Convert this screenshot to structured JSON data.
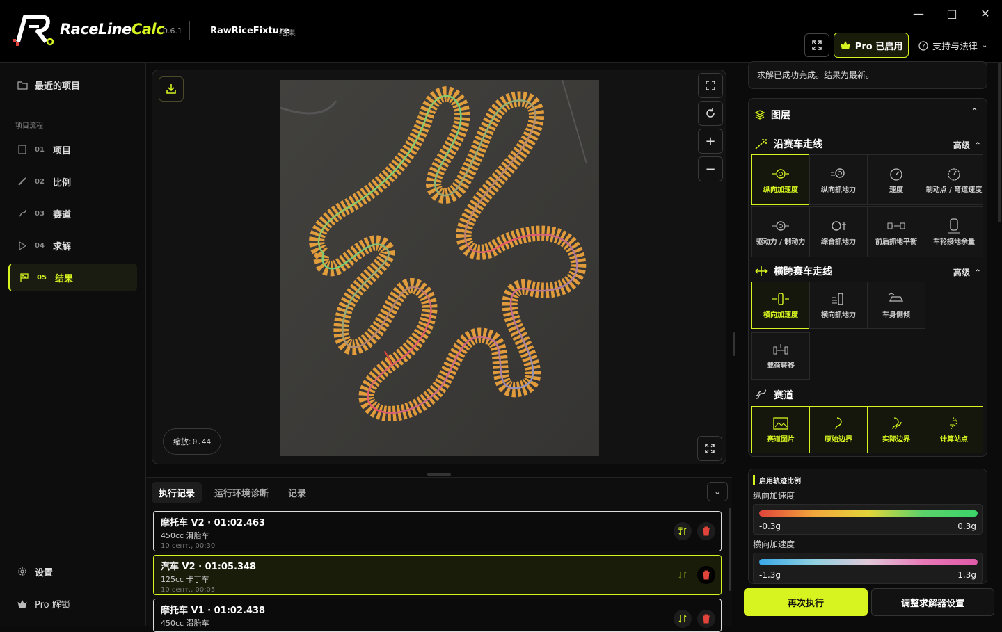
{
  "app": {
    "name_a": "RaceLine",
    "name_b": "Calc",
    "version": "0.6.1",
    "project_name": "RawRiceFixture",
    "project_sub": "结果"
  },
  "titlebar": {
    "pro_label": "Pro 已启用",
    "support_label": "支持与法律"
  },
  "sidebar": {
    "recent": "最近的项目",
    "section": "项目流程",
    "steps": [
      {
        "num": "01",
        "label": "项目"
      },
      {
        "num": "02",
        "label": "比例"
      },
      {
        "num": "03",
        "label": "赛道"
      },
      {
        "num": "04",
        "label": "求解"
      },
      {
        "num": "05",
        "label": "结果"
      }
    ],
    "settings": "设置",
    "pro_unlock": "Pro 解锁"
  },
  "viewer": {
    "zoom_label": "缩放:",
    "zoom_value": "0.44"
  },
  "bottom": {
    "tabs": [
      "执行记录",
      "运行环境诊断",
      "记录"
    ],
    "runs": [
      {
        "title": "摩托车 V2 · 01:02.463",
        "sub": "450cc 滑胎车",
        "date": "10 сент., 00:30"
      },
      {
        "title": "汽车 V2 · 01:05.348",
        "sub": "125cc 卡丁车",
        "date": "10 сент., 00:05"
      },
      {
        "title": "摩托车 V1 · 01:02.438",
        "sub": "450cc 滑胎车",
        "date": ""
      }
    ]
  },
  "right": {
    "status": "求解已成功完成。结果为最新。",
    "layers_title": "图层",
    "along_title": "沿赛车走线",
    "across_title": "横跨赛车走线",
    "track_title": "赛道",
    "advanced": "高级",
    "along_items": [
      "纵向加速度",
      "纵向抓地力",
      "速度",
      "制动点 / 弯道速度",
      "驱动力 / 制动力",
      "综合抓地力",
      "前后抓地平衡",
      "车轮接地余量"
    ],
    "across_items": [
      "横向加速度",
      "横向抓地力",
      "车身侧倾",
      "载荷转移"
    ],
    "track_items": [
      "赛道图片",
      "原始边界",
      "实际边界",
      "计算站点"
    ],
    "legend_title": "启用轨迹比例",
    "legend": [
      {
        "label": "纵向加速度",
        "min": "-0.3g",
        "max": "0.3g"
      },
      {
        "label": "横向加速度",
        "min": "-1.3g",
        "max": "1.3g"
      }
    ],
    "rerun": "再次执行",
    "adjust": "调整求解器设置"
  },
  "colors": {
    "accent": "#d7f420",
    "delete": "#e0443a"
  }
}
